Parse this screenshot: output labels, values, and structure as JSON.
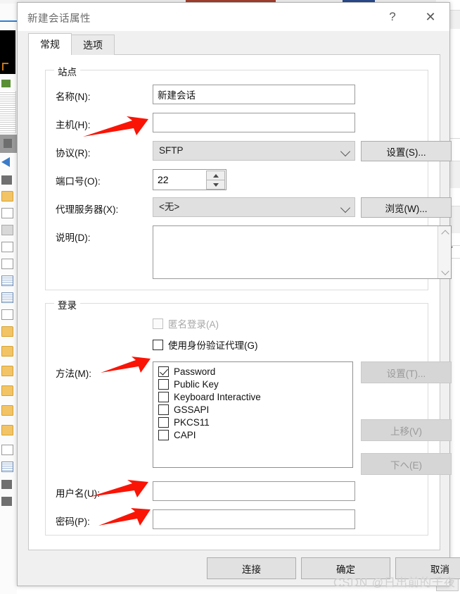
{
  "window": {
    "title": "新建会话属性",
    "help_label": "?",
    "close_label": "✕"
  },
  "tabs": [
    {
      "label": "常规",
      "active": true
    },
    {
      "label": "选项",
      "active": false
    }
  ],
  "site_group": {
    "legend": "站点",
    "fields": {
      "name": {
        "label": "名称(N):",
        "value": "新建会话",
        "placeholder": ""
      },
      "host": {
        "label": "主机(H):",
        "value": "",
        "placeholder": ""
      },
      "protocol": {
        "label": "协议(R):",
        "value": "SFTP",
        "disabled": true
      },
      "port": {
        "label": "端口号(O):",
        "value": "22"
      },
      "proxy": {
        "label": "代理服务器(X):",
        "value": "<无>",
        "disabled": true
      },
      "description": {
        "label": "说明(D):",
        "value": "",
        "placeholder": ""
      }
    },
    "buttons": {
      "settings": "设置(S)...",
      "browse": "浏览(W)..."
    }
  },
  "login_group": {
    "legend": "登录",
    "anonymous": {
      "label": "匿名登录(A)",
      "checked": false,
      "disabled": true
    },
    "auth_agent": {
      "label": "使用身份验证代理(G)",
      "checked": false,
      "disabled": false
    },
    "method_label": "方法(M):",
    "methods": [
      {
        "label": "Password",
        "checked": true
      },
      {
        "label": "Public Key",
        "checked": false
      },
      {
        "label": "Keyboard Interactive",
        "checked": false
      },
      {
        "label": "GSSAPI",
        "checked": false
      },
      {
        "label": "PKCS11",
        "checked": false
      },
      {
        "label": "CAPI",
        "checked": false
      }
    ],
    "buttons": {
      "settings": "设置(T)...",
      "move_up": "上移(V)",
      "move_down": "下へ(E)"
    },
    "username": {
      "label": "用户名(U):",
      "value": "",
      "placeholder": ""
    },
    "password": {
      "label": "密码(P):",
      "value": "",
      "placeholder": ""
    }
  },
  "footer": {
    "connect": "连接",
    "ok": "确定",
    "cancel": "取消"
  },
  "watermark": "CSDN @日出前的千夜",
  "colors": {
    "annotation_arrow": "#fa1405",
    "dialog_bg": "#f0f0f0",
    "panel_bg": "#ffffff",
    "title_text": "#6c6c6c",
    "accent_blue": "#0078d7"
  }
}
